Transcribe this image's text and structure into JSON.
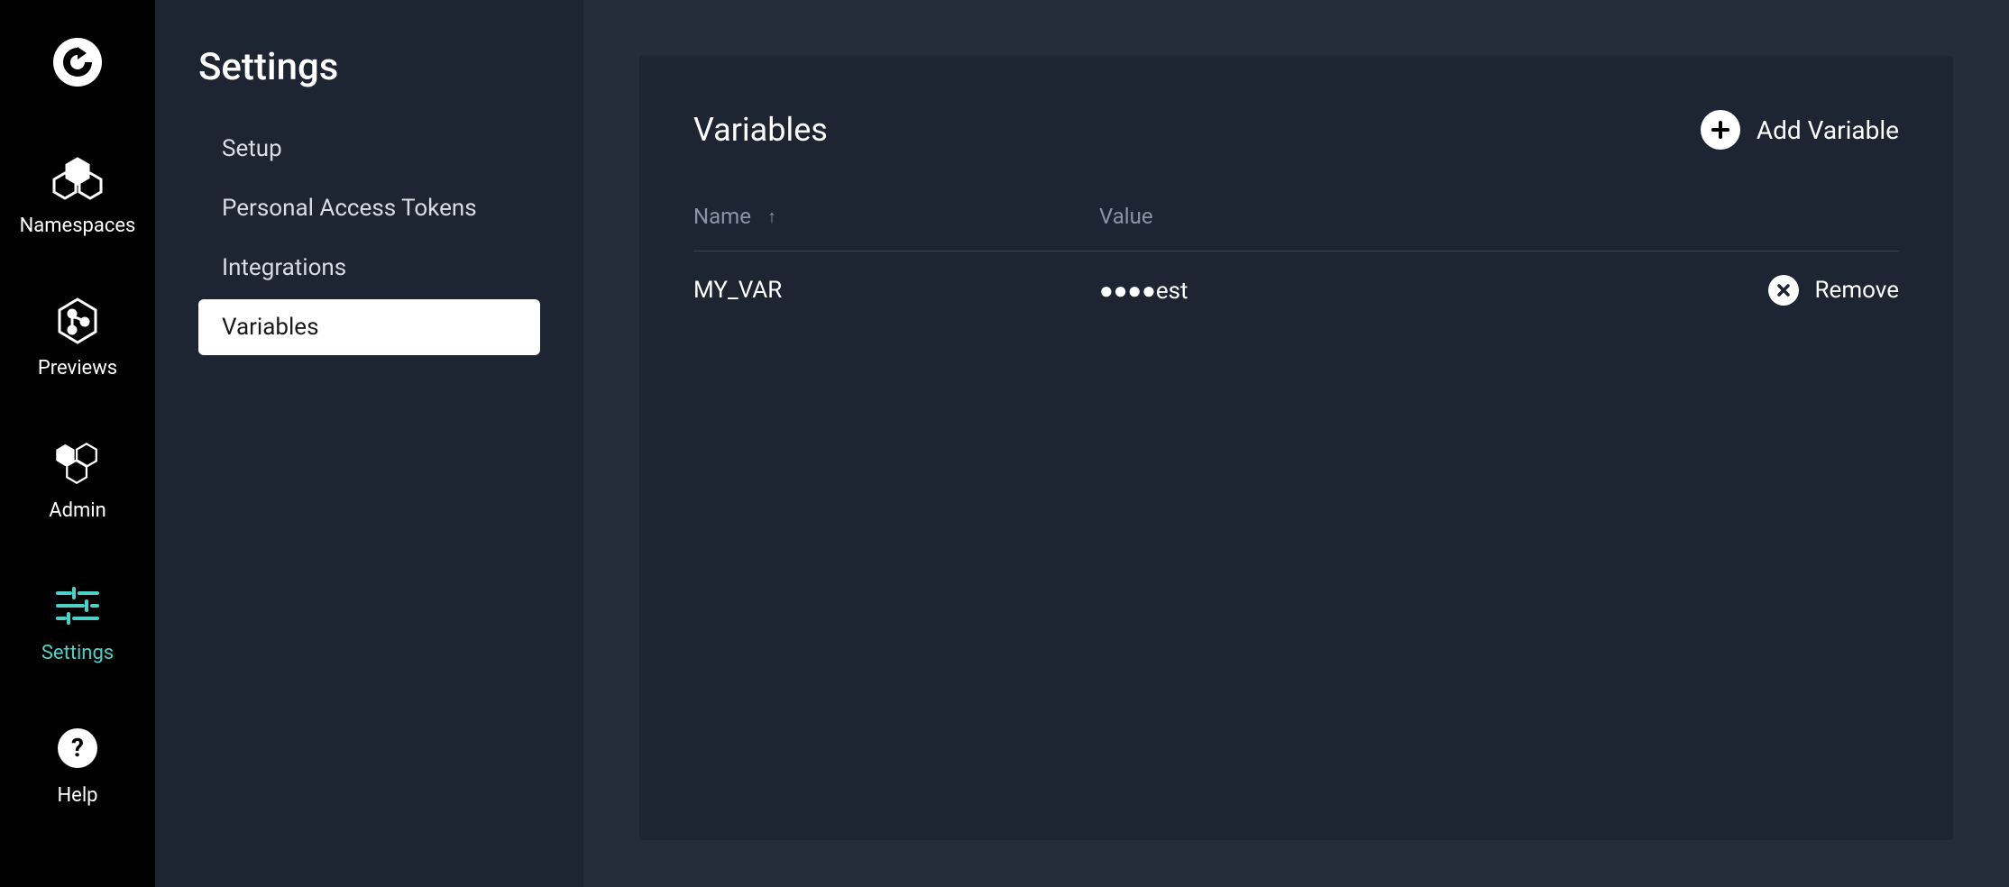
{
  "nav": {
    "items": [
      {
        "id": "namespaces",
        "label": "Namespaces"
      },
      {
        "id": "previews",
        "label": "Previews"
      },
      {
        "id": "admin",
        "label": "Admin"
      },
      {
        "id": "settings",
        "label": "Settings"
      },
      {
        "id": "help",
        "label": "Help"
      }
    ],
    "active": "settings"
  },
  "secondary": {
    "title": "Settings",
    "items": [
      {
        "id": "setup",
        "label": "Setup"
      },
      {
        "id": "pat",
        "label": "Personal Access Tokens"
      },
      {
        "id": "integrations",
        "label": "Integrations"
      },
      {
        "id": "variables",
        "label": "Variables"
      }
    ],
    "active": "variables"
  },
  "panel": {
    "title": "Variables",
    "add_label": "Add Variable",
    "columns": {
      "name": "Name",
      "value": "Value"
    },
    "sort_direction": "asc",
    "rows": [
      {
        "name": "MY_VAR",
        "value_masked": "●●●●est",
        "remove_label": "Remove"
      }
    ]
  }
}
